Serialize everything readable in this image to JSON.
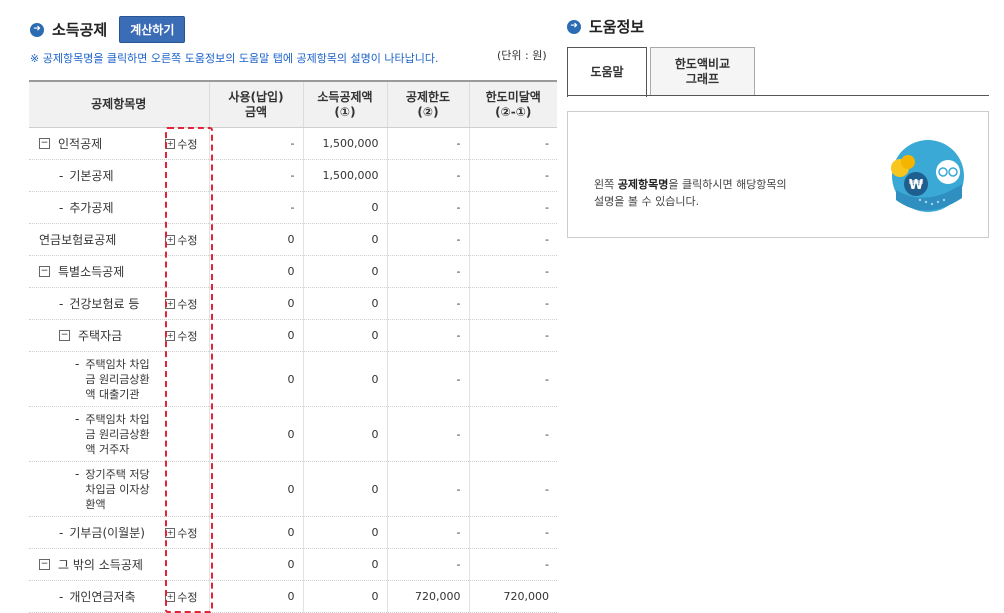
{
  "left": {
    "title": "소득공제",
    "calc_button": "계산하기",
    "notice": "※ 공제항목명을 클릭하면 오른쪽 도움정보의 도움말 탭에 공제항목의 설명이 나타납니다.",
    "unit": "(단위 : 원)",
    "headers": {
      "item": "공제항목명",
      "use_line1": "사용(납입)",
      "use_line2": "금액",
      "amount_line1": "소득공제액",
      "amount_line2": "(①)",
      "limit_line1": "공제한도",
      "limit_line2": "(②)",
      "under_line1": "한도미달액",
      "under_line2": "(②-①)"
    },
    "edit_label": "수정",
    "rows": [
      {
        "name": "인적공제",
        "use": "-",
        "amount": "1,500,000",
        "limit": "-",
        "under": "-"
      },
      {
        "name": "기본공제",
        "use": "-",
        "amount": "1,500,000",
        "limit": "-",
        "under": "-"
      },
      {
        "name": "추가공제",
        "use": "-",
        "amount": "0",
        "limit": "-",
        "under": "-"
      },
      {
        "name": "연금보험료공제",
        "use": "0",
        "amount": "0",
        "limit": "-",
        "under": "-"
      },
      {
        "name": "특별소득공제",
        "use": "0",
        "amount": "0",
        "limit": "-",
        "under": "-"
      },
      {
        "name": "건강보험료 등",
        "use": "0",
        "amount": "0",
        "limit": "-",
        "under": "-"
      },
      {
        "name": "주택자금",
        "use": "0",
        "amount": "0",
        "limit": "-",
        "under": "-"
      },
      {
        "name_l1": "주택임차 차입",
        "name_l2": "금 원리금상환",
        "name_l3": "액 대출기관",
        "use": "0",
        "amount": "0",
        "limit": "-",
        "under": "-"
      },
      {
        "name_l1": "주택임차 차입",
        "name_l2": "금 원리금상환",
        "name_l3": "액 거주자",
        "use": "0",
        "amount": "0",
        "limit": "-",
        "under": "-"
      },
      {
        "name_l1": "장기주택 저당",
        "name_l2": "차입금 이자상",
        "name_l3": "환액",
        "use": "0",
        "amount": "0",
        "limit": "-",
        "under": "-"
      },
      {
        "name": "기부금(이월분)",
        "use": "0",
        "amount": "0",
        "limit": "-",
        "under": "-"
      },
      {
        "name": "그 밖의 소득공제",
        "use": "0",
        "amount": "0",
        "limit": "-",
        "under": "-"
      },
      {
        "name": "개인연금저축",
        "use": "0",
        "amount": "0",
        "limit": "720,000",
        "under": "720,000"
      }
    ]
  },
  "right": {
    "title": "도움정보",
    "tab_help": "도움말",
    "tab_graph_l1": "한도액비교",
    "tab_graph_l2": "그래프",
    "help_pre": "왼쪽 ",
    "help_bold": "공제항목명",
    "help_post": "을 클릭하시면 해당항목의",
    "help_line2": "설명을 볼 수 있습니다."
  },
  "colors": {
    "accent": "#3a6db5",
    "highlight": "#e0243a",
    "notice": "#1a62c9"
  }
}
